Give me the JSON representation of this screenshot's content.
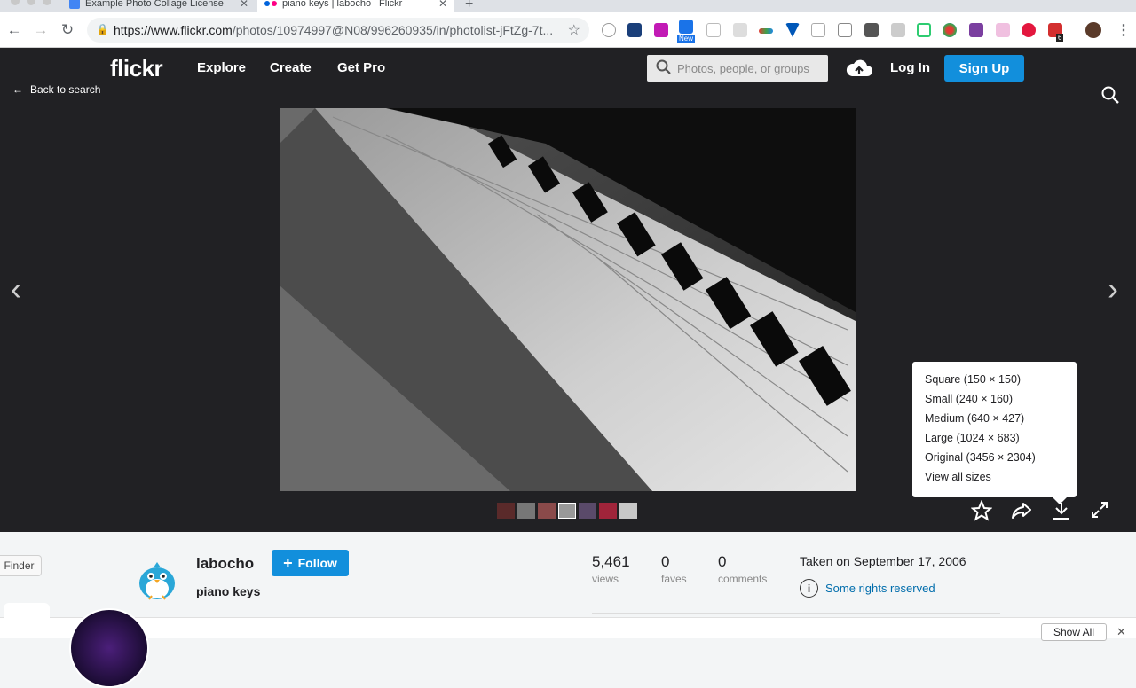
{
  "browser": {
    "tabs": [
      {
        "label": "Example Photo Collage License",
        "active": false
      },
      {
        "label": "piano keys | labocho | Flickr",
        "active": true
      }
    ],
    "url_host": "https://www.flickr.com",
    "url_path": "/photos/10974997@N08/996260935/in/photolist-jFtZg-7t...",
    "extension_new_badge": "New",
    "extension_count_badge": "6"
  },
  "flickr_header": {
    "logo": "flickr",
    "nav": [
      "Explore",
      "Create",
      "Get Pro"
    ],
    "search_placeholder": "Photos, people, or groups",
    "login": "Log In",
    "signup": "Sign Up"
  },
  "viewer": {
    "back_label": "Back to search",
    "download_sizes": [
      "Square (150 × 150)",
      "Small (240 × 160)",
      "Medium (640 × 427)",
      "Large (1024 × 683)",
      "Original (3456 × 2304)",
      "View all sizes"
    ]
  },
  "photo_info": {
    "username": "labocho",
    "follow_label": "Follow",
    "title": "piano keys",
    "views_count": "5,461",
    "views_label": "views",
    "faves_count": "0",
    "faves_label": "faves",
    "comments_count": "0",
    "comments_label": "comments",
    "taken": "Taken on September 17, 2006",
    "license": "Some rights reserved",
    "show_all": "Show All"
  },
  "desktop": {
    "finder_tooltip": "Finder"
  }
}
